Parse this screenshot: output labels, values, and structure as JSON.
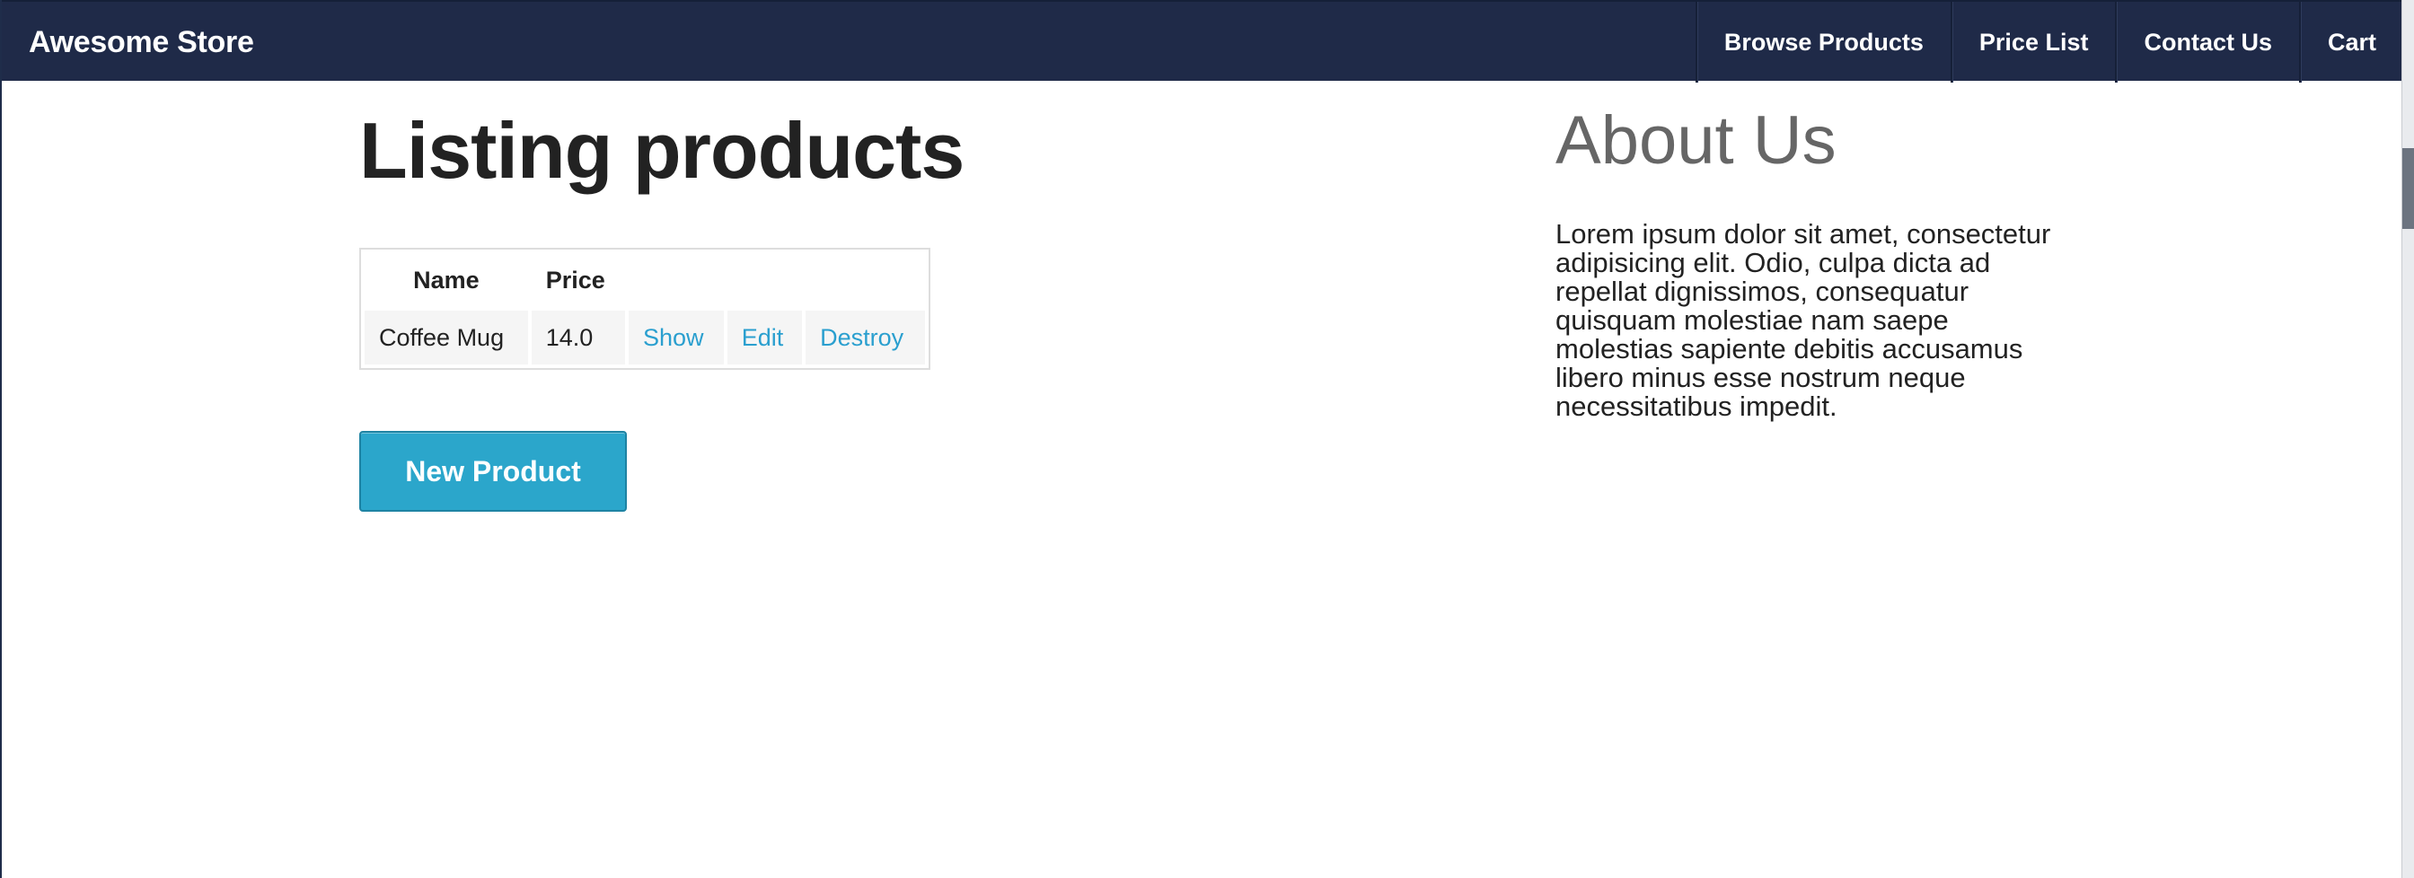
{
  "header": {
    "brand": "Awesome Store",
    "nav": [
      {
        "label": "Browse Products"
      },
      {
        "label": "Price List"
      },
      {
        "label": "Contact Us"
      },
      {
        "label": "Cart"
      }
    ]
  },
  "main": {
    "title": "Listing products",
    "table": {
      "headers": [
        "Name",
        "Price"
      ],
      "rows": [
        {
          "name": "Coffee Mug",
          "price": "14.0",
          "actions": [
            "Show",
            "Edit",
            "Destroy"
          ]
        }
      ]
    },
    "new_button": "New Product"
  },
  "aside": {
    "title": "About Us",
    "text": "Lorem ipsum dolor sit amet, consectetur adipisicing elit. Odio, culpa dicta ad repellat dignissimos, consequatur quisquam molestiae nam saepe molestias sapiente debitis accusamus libero minus esse nostrum neque necessitatibus impedit."
  },
  "colors": {
    "header_bg": "#1f2a48",
    "link": "#2a9fcf",
    "button_bg": "#2ba6cb"
  }
}
